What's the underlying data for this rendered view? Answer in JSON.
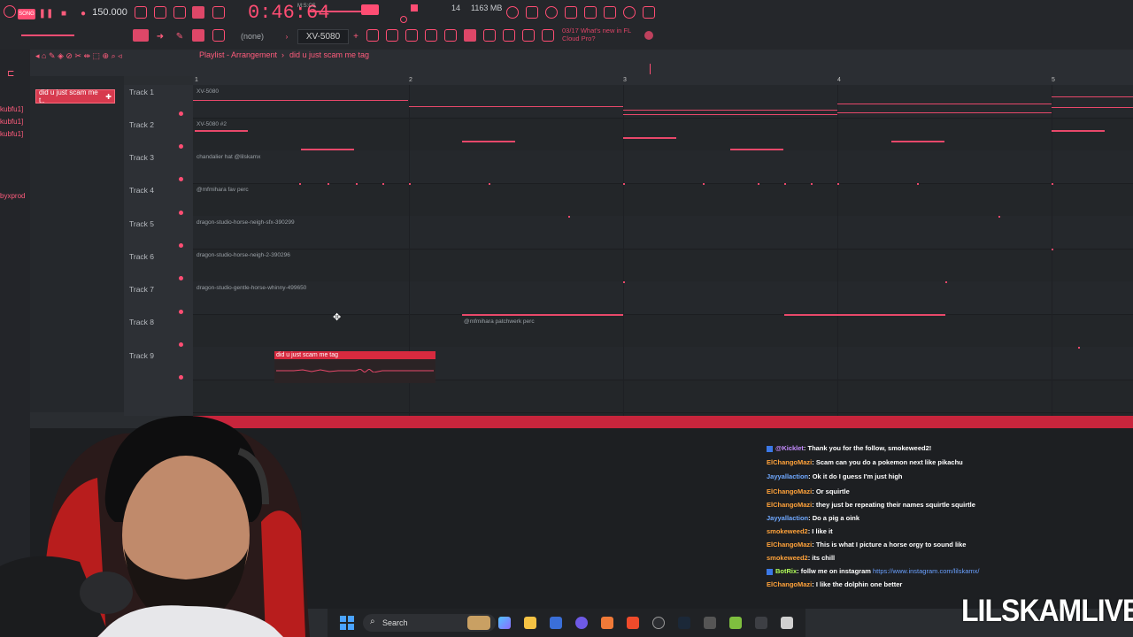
{
  "toolbar": {
    "tempo": "150.000",
    "time": "0:46:64",
    "time_unit": "M:S:CS",
    "cpu": "14",
    "memory": "1163 MB",
    "pattern": "XV-5080",
    "none_label": "(none)",
    "news_line1": "03/17  What's new in FL",
    "news_line2": "Cloud Pro?"
  },
  "browser": {
    "items": [
      "kubfu1]",
      "kubfu1]",
      "kubfu1]",
      "byxprod"
    ]
  },
  "playlist": {
    "title": "Playlist - Arrangement",
    "separator": "›",
    "pattern_name": "did u just scam me tag",
    "pattern_item": "did u just scam me t..",
    "ruler": [
      "1",
      "2",
      "3",
      "4",
      "5"
    ],
    "tracks": [
      {
        "label": "Track 1",
        "clip": "XV-5080"
      },
      {
        "label": "Track 2",
        "clip": "XV-5080 #2"
      },
      {
        "label": "Track 3",
        "clip": "chandalier hat @lilskamx"
      },
      {
        "label": "Track 4",
        "clip": "@mfmihara fav perc"
      },
      {
        "label": "Track 5",
        "clip": "dragon-studio-horse-neigh-sfx-390299"
      },
      {
        "label": "Track 6",
        "clip": "dragon-studio-horse-neigh-2-390296"
      },
      {
        "label": "Track 7",
        "clip": "dragon-studio-gentle-horse-whinny-499650"
      },
      {
        "label": "Track 8",
        "clip": "@mfmihara patchwerk perc"
      },
      {
        "label": "Track 9",
        "clip": "did u just scam me tag"
      }
    ]
  },
  "chat": [
    {
      "user": "@Kicklet",
      "msg": ": Thank you for the follow, smokeweed2!",
      "color": "purple"
    },
    {
      "user": "ElChangoMazi",
      "msg": ": Scam can you do a pokemon next like pikachu",
      "color": "blue"
    },
    {
      "user": "Jayyallaction",
      "msg": ": Ok it do    I guess I'm just high",
      "color": "blue"
    },
    {
      "user": "ElChangoMazi",
      "msg": ": Or squirtle",
      "color": "orange"
    },
    {
      "user": "ElChangoMazi",
      "msg": ": they just be repeating their names squirtle squirtle",
      "color": "blue"
    },
    {
      "user": "Jayyallaction",
      "msg": ": Do a pig a oink",
      "color": "blue"
    },
    {
      "user": "smokeweed2",
      "msg": ": I like it",
      "color": "orange"
    },
    {
      "user": "ElChangoMazi",
      "msg": ": This is what I picture a horse orgy to sound like",
      "color": "blue"
    },
    {
      "user": "smokeweed2",
      "msg": ": its chill",
      "color": "orange"
    },
    {
      "user": "BotRix",
      "msg": ": follw me on instagram ",
      "link": "https://www.instagram.com/lilskamx/",
      "color": "green"
    },
    {
      "user": "ElChangoMazi",
      "msg": ": I like the dolphin one better",
      "color": "blue"
    }
  ],
  "taskbar": {
    "search_label": "Search"
  },
  "brand": "LILSKAMLIVE",
  "colors": {
    "accent": "#ff4d73",
    "background": "#1b1d20"
  }
}
